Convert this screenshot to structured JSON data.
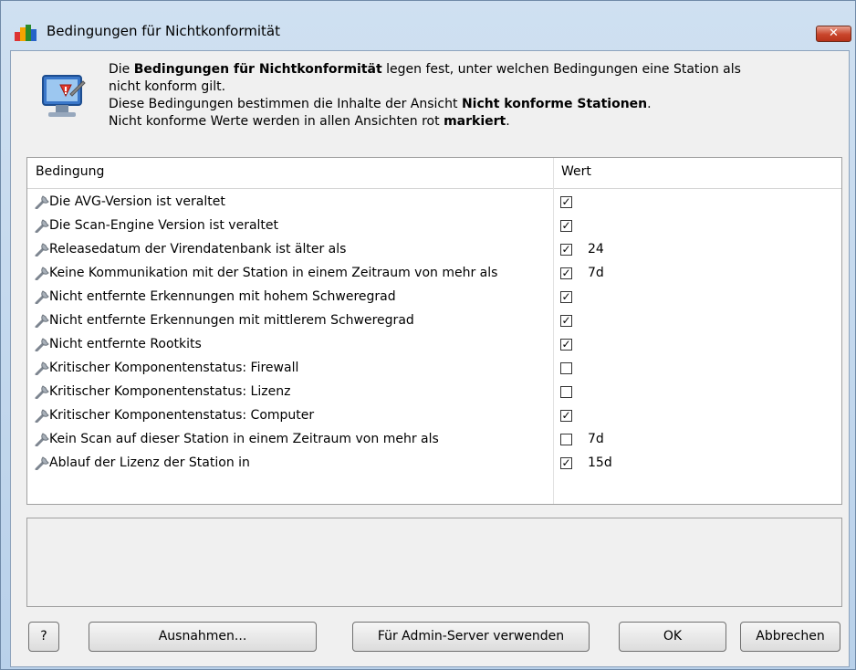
{
  "window": {
    "title": "Bedingungen für Nichtkonformität",
    "close_label": "✕"
  },
  "description": {
    "line1_pre": "Die ",
    "line1_bold": "Bedingungen für Nichtkonformität",
    "line1_post": " legen fest, unter welchen Bedingungen eine Station als",
    "line2": "nicht konform gilt.",
    "line3_pre": "Diese Bedingungen bestimmen die Inhalte der Ansicht ",
    "line3_bold": "Nicht konforme Stationen",
    "line3_post": ".",
    "line4_pre": "Nicht konforme Werte werden in allen Ansichten rot ",
    "line4_bold": "markiert",
    "line4_post": "."
  },
  "grid": {
    "headers": {
      "condition": "Bedingung",
      "value": "Wert"
    },
    "rows": [
      {
        "label": "Die AVG-Version ist veraltet",
        "checked": true,
        "value": ""
      },
      {
        "label": "Die Scan-Engine Version ist veraltet",
        "checked": true,
        "value": ""
      },
      {
        "label": "Releasedatum der Virendatenbank ist älter als",
        "checked": true,
        "value": "24"
      },
      {
        "label": "Keine Kommunikation mit der Station in einem Zeitraum von mehr als",
        "checked": true,
        "value": "7d"
      },
      {
        "label": "Nicht entfernte Erkennungen mit hohem Schweregrad",
        "checked": true,
        "value": ""
      },
      {
        "label": "Nicht entfernte Erkennungen mit mittlerem Schweregrad",
        "checked": true,
        "value": ""
      },
      {
        "label": "Nicht entfernte Rootkits",
        "checked": true,
        "value": ""
      },
      {
        "label": "Kritischer Komponentenstatus: Firewall",
        "checked": false,
        "value": ""
      },
      {
        "label": "Kritischer Komponentenstatus: Lizenz",
        "checked": false,
        "value": ""
      },
      {
        "label": "Kritischer Komponentenstatus: Computer",
        "checked": true,
        "value": ""
      },
      {
        "label": "Kein Scan auf dieser Station in einem Zeitraum von mehr als",
        "checked": false,
        "value": "7d"
      },
      {
        "label": "Ablauf der Lizenz der Station in",
        "checked": true,
        "value": "15d"
      }
    ]
  },
  "buttons": {
    "help": "?",
    "exceptions": "Ausnahmen...",
    "admin_server": "Für Admin-Server verwenden",
    "ok": "OK",
    "cancel": "Abbrechen"
  },
  "icons": {
    "app": "avg-logo-icon",
    "header": "computer-warning-icon",
    "row": "wrench-icon"
  }
}
